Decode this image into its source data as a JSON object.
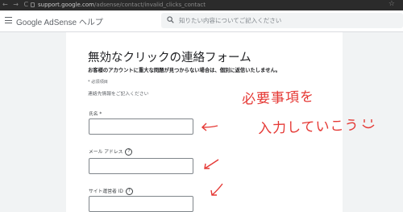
{
  "browser": {
    "nav_glyphs": "← → C",
    "url_host": "support.google.com",
    "url_path": "/adsense/contact/invalid_clicks_contact",
    "bookmark_icon": "star-icon"
  },
  "header": {
    "app_title": "Google AdSense ヘルプ",
    "search_placeholder": "知りたい内容についてご記入ください"
  },
  "form": {
    "title": "無効なクリックの連絡フォーム",
    "description": "お客様のアカウントに重大な問題が見つからない場合は、個別に返信いたしません。",
    "required_note": "* 必須項目",
    "contact_note": "連絡先情報をご記入ください",
    "fields": [
      {
        "label": "氏名 *",
        "value": ""
      },
      {
        "label": "メール アドレス",
        "value": "",
        "help_icon": "help-circle-icon"
      },
      {
        "label": "サイト運営者 ID",
        "value": "",
        "help_icon": "help-circle-icon"
      }
    ]
  },
  "annotation": {
    "line1": "必要事項を",
    "line2": "入力していこう",
    "color": "#e53935"
  }
}
